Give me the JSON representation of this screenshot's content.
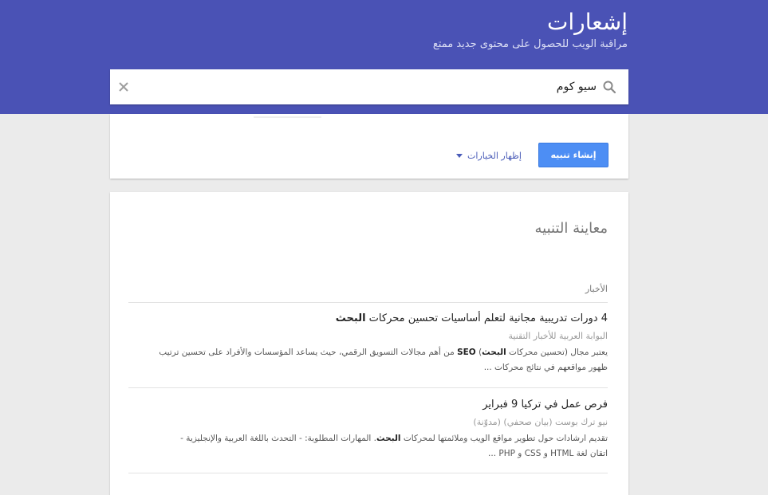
{
  "header": {
    "title": "إشعارات",
    "subtitle": "مراقبة الويب للحصول على محتوى جديد ممتع"
  },
  "search": {
    "value": "سيو كوم",
    "icon": "search-icon",
    "clear_icon": "close-icon"
  },
  "options": {
    "create_button": "إنشاء تنبيه",
    "show_options": "إظهار الخيارات"
  },
  "preview": {
    "title": "معاينة التنبيه",
    "section": "الأخبار",
    "results": [
      {
        "title_pre": "4 دورات تدريبية مجانية لتعلم أساسيات تحسين محركات ",
        "title_bold": "البحث",
        "source": "البوابة العربية للأخبار التقنية",
        "snippet_1a": "يعتبر مجال (تحسين محركات ",
        "snippet_1b": "البحث",
        "snippet_1c": ") ",
        "snippet_1d": "SEO",
        "snippet_1e": " من أهم مجالات التسويق الرقمي، حيث يساعد المؤسسات والأفراد على تحسين ترتيب",
        "snippet_2": "ظهور مواقعهم في نتائج محركات ..."
      },
      {
        "title_pre": "فرص عمل في تركيا 9 فبراير",
        "title_bold": "",
        "source": "نيو ترك بوست (بيان صحفي) (مدوّنة)",
        "snippet_1a": "تقديم ارشادات حول تطوير مواقع الويب وملائمتها لمحركات ",
        "snippet_1b": "البحث",
        "snippet_1c": ". المهارات المطلوبة: - التحدث باللغة العربية والإنجليزية -",
        "snippet_1d": "",
        "snippet_1e": "",
        "snippet_2": "اتقان لغة HTML و CSS و PHP ..."
      }
    ]
  },
  "colors": {
    "header_bg": "#4a52b5",
    "primary_button": "#4d8ef4",
    "link": "#4a5cb8"
  }
}
